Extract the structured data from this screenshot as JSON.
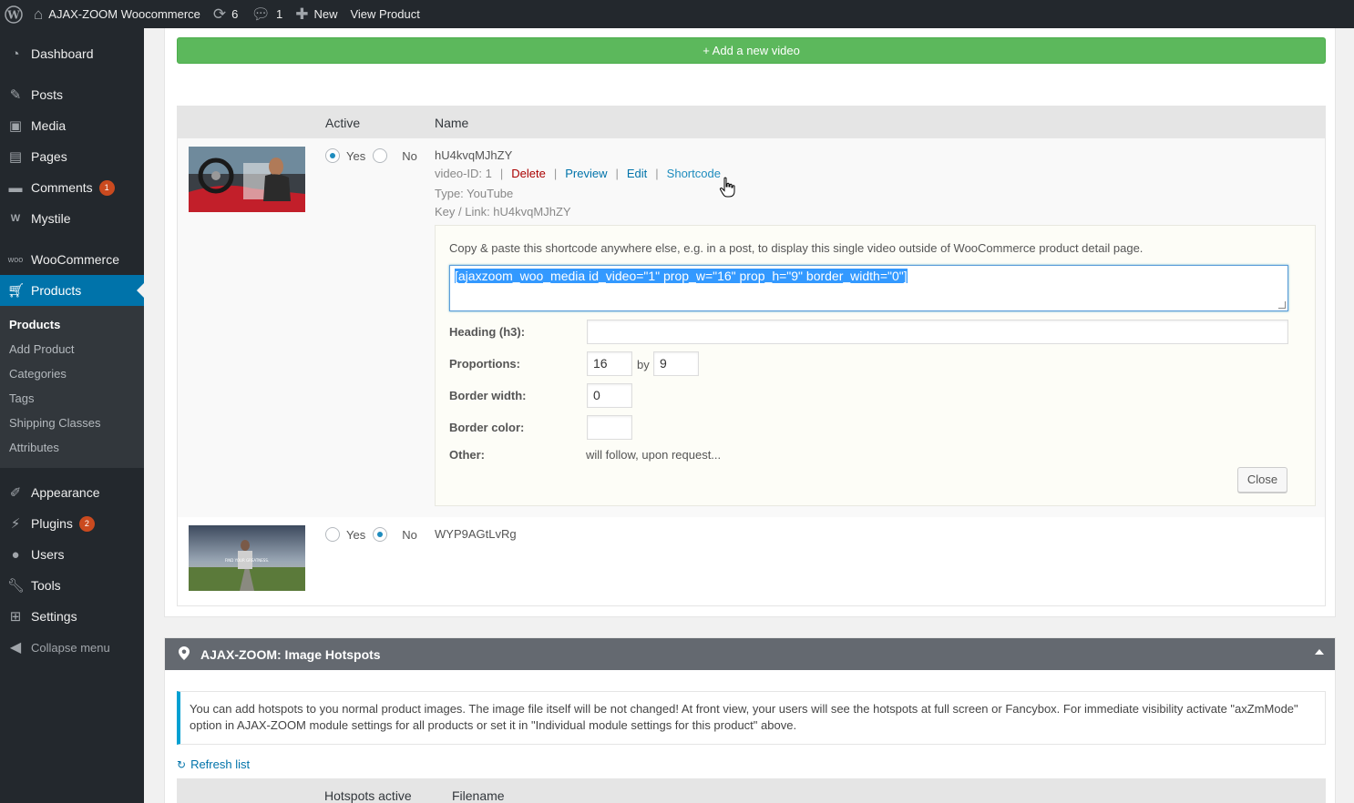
{
  "admin_bar": {
    "site_name": "AJAX-ZOOM Woocommerce",
    "updates_count": "6",
    "comments_count": "1",
    "new_label": "New",
    "view_product_label": "View Product"
  },
  "sidebar": {
    "dashboard": "Dashboard",
    "posts": "Posts",
    "media": "Media",
    "pages": "Pages",
    "comments": "Comments",
    "comments_badge": "1",
    "mystile": "Mystile",
    "woocommerce": "WooCommerce",
    "products": "Products",
    "submenu": [
      "Products",
      "Add Product",
      "Categories",
      "Tags",
      "Shipping Classes",
      "Attributes"
    ],
    "appearance": "Appearance",
    "plugins": "Plugins",
    "plugins_badge": "2",
    "users": "Users",
    "tools": "Tools",
    "settings": "Settings",
    "collapse": "Collapse menu"
  },
  "videos": {
    "add_button": "+ Add a new video",
    "col_active": "Active",
    "col_name": "Name",
    "yes_label": "Yes",
    "no_label": "No",
    "row1": {
      "name": "hU4kvqMJhZY",
      "video_id": "video-ID: 1",
      "delete": "Delete",
      "preview": "Preview",
      "edit": "Edit",
      "shortcode": "Shortcode",
      "type": "Type: YouTube",
      "key": "Key / Link: hU4kvqMJhZY",
      "active": "yes"
    },
    "row2": {
      "name": "WYP9AGtLvRg",
      "active": "no",
      "thumb_text": "FIND YOUR GREATNESS."
    }
  },
  "shortcode_panel": {
    "description": "Copy & paste this shortcode anywhere else, e.g. in a post, to display this single video outside of WooCommerce product detail page.",
    "shortcode": "[ajaxzoom_woo_media id_video=\"1\" prop_w=\"16\" prop_h=\"9\" border_width=\"0\"]",
    "heading_label": "Heading (h3):",
    "heading_value": "",
    "proportions_label": "Proportions:",
    "prop_w": "16",
    "by_label": "by",
    "prop_h": "9",
    "border_width_label": "Border width:",
    "border_width": "0",
    "border_color_label": "Border color:",
    "border_color": "",
    "other_label": "Other:",
    "other_value": "will follow, upon request...",
    "close_label": "Close"
  },
  "hotspots": {
    "title": "AJAX-ZOOM: Image Hotspots",
    "notice": "You can add hotspots to you normal product images. The image file itself will be not changed! At front view, your users will see the hotspots at full screen or Fancybox. For immediate visibility activate \"axZmMode\" option in AJAX-ZOOM module settings for all products or set it in \"Individual module settings for this product\" above.",
    "refresh": "Refresh list",
    "col_active": "Hotspots active",
    "col_filename": "Filename"
  },
  "colors": {
    "admin_dark": "#23282d",
    "accent": "#0073aa",
    "green": "#5cb85c",
    "badge": "#ca4a1f",
    "delete": "#aa0000"
  }
}
